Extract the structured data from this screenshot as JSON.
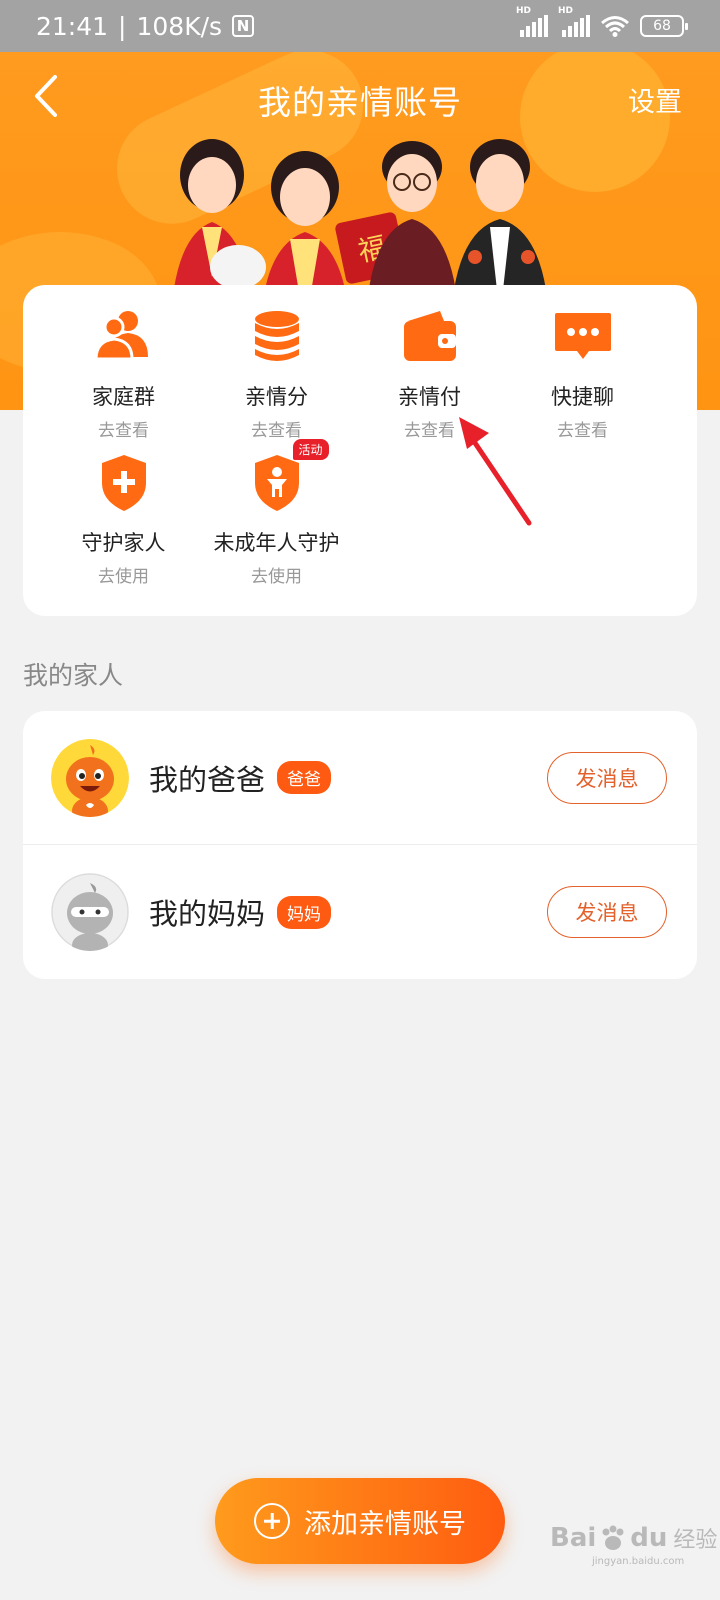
{
  "status_bar": {
    "time": "21:41",
    "speed": "108K/s",
    "nfc_icon": "nfc-icon",
    "signal_label_1": "HD",
    "signal_label_2": "HD",
    "battery": "68"
  },
  "header": {
    "title": "我的亲情账号",
    "settings_label": "设置",
    "back_icon": "chevron-left-icon",
    "illustration_text": "福"
  },
  "features": [
    {
      "label": "家庭群",
      "sub": "去查看",
      "icon": "users-icon"
    },
    {
      "label": "亲情分",
      "sub": "去查看",
      "icon": "database-stack-icon"
    },
    {
      "label": "亲情付",
      "sub": "去查看",
      "icon": "wallet-icon"
    },
    {
      "label": "快捷聊",
      "sub": "去查看",
      "icon": "chat-bubble-icon"
    },
    {
      "label": "守护家人",
      "sub": "去使用",
      "icon": "shield-plus-icon"
    },
    {
      "label": "未成年人守护",
      "sub": "去使用",
      "icon": "shield-child-icon",
      "badge": "活动"
    }
  ],
  "family_section": {
    "title": "我的家人",
    "members": [
      {
        "name": "我的爸爸",
        "role": "爸爸",
        "action": "发消息"
      },
      {
        "name": "我的妈妈",
        "role": "妈妈",
        "action": "发消息"
      }
    ]
  },
  "add_account_label": "添加亲情账号",
  "watermark": {
    "brand_left": "Bai",
    "brand_right": "du",
    "cn": "经验",
    "url": "jingyan.baidu.com"
  },
  "colors": {
    "accent": "#ff6a13",
    "header": "#ff9b1f",
    "arrow": "#e8202a"
  }
}
